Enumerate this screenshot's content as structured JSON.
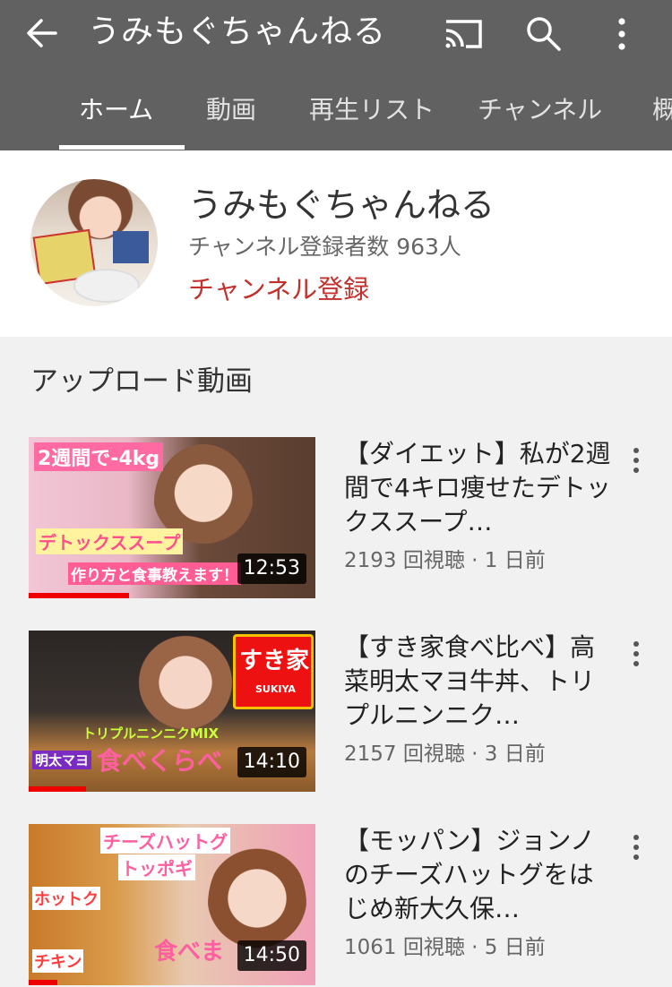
{
  "appbar": {
    "title": "うみもぐちゃんねる",
    "icons": [
      "back-arrow-icon",
      "cast-icon",
      "search-icon",
      "more-vert-icon"
    ],
    "tabs": [
      {
        "label": "ホーム",
        "active": true
      },
      {
        "label": "動画",
        "active": false
      },
      {
        "label": "再生リスト",
        "active": false
      },
      {
        "label": "チャンネル",
        "active": false
      },
      {
        "label": "概",
        "active": false
      }
    ],
    "background_color": "#616161"
  },
  "channel": {
    "name": "うみもぐちゃんねる",
    "subscribers": "チャンネル登録者数 963人",
    "subscribe_label": "チャンネル登録",
    "subscribe_color": "#c4302b"
  },
  "uploads": {
    "section_title": "アップロード動画",
    "videos": [
      {
        "title": "【ダイエット】私が2週間で4キロ痩せたデトックススープ…",
        "meta": "2193 回視聴 · 1 日前",
        "duration": "12:53",
        "watched_fraction": 0.35,
        "thumb_texts": [
          "2週間で-4kg",
          "デトックススープ",
          "作り方と食事教えます！"
        ]
      },
      {
        "title": "【すき家食べ比べ】高菜明太マヨ牛丼、トリプルニンニク…",
        "meta": "2157 回視聴 · 3 日前",
        "duration": "14:10",
        "watched_fraction": 0.2,
        "thumb_texts": [
          "すき家",
          "SUKIYA",
          "トリプルニンニクMIX",
          "明太マヨ",
          "食べくらべ"
        ]
      },
      {
        "title": "【モッパン】ジョンノのチーズハットグをはじめ新大久保…",
        "meta": "1061 回視聴 · 5 日前",
        "duration": "14:50",
        "watched_fraction": 0.1,
        "thumb_texts": [
          "チーズハットグ",
          "トッポギ",
          "ホットク",
          "チキン",
          "食べま"
        ]
      }
    ]
  }
}
